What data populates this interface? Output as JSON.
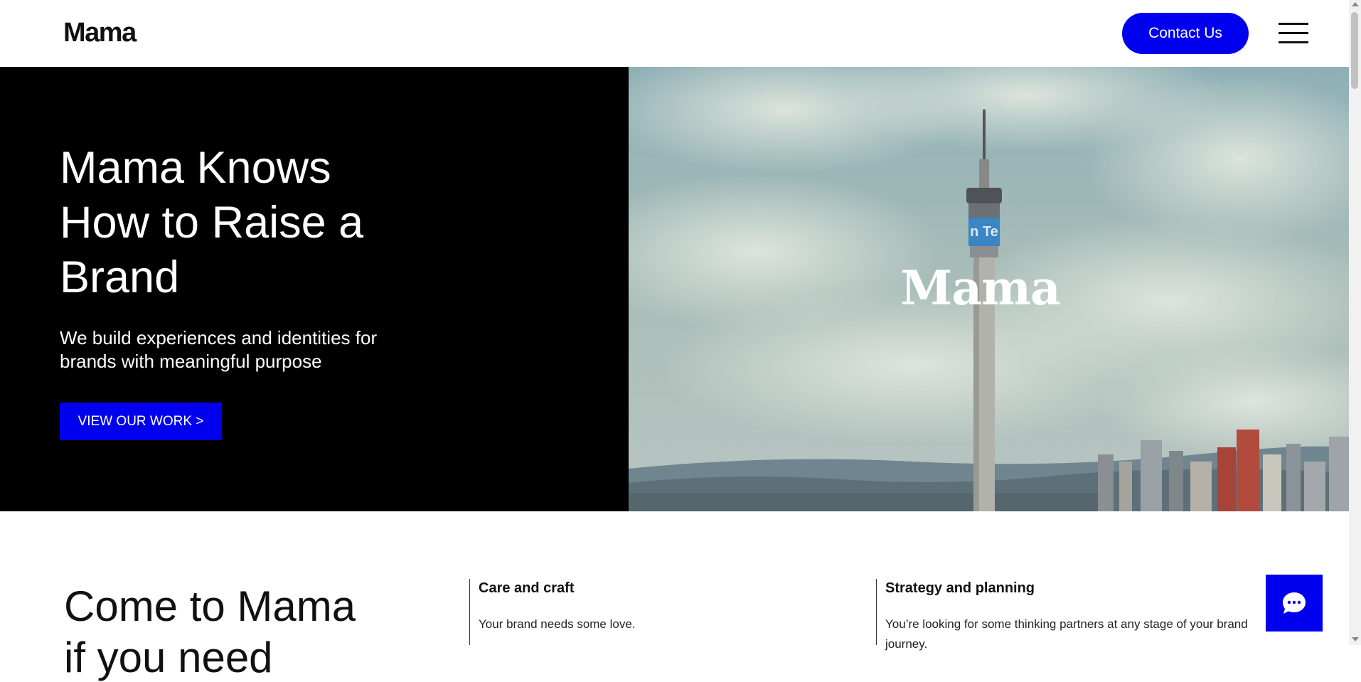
{
  "header": {
    "logo": "Mama",
    "contact_label": "Contact Us",
    "menu_icon": "hamburger-menu-icon"
  },
  "hero": {
    "title": "Mama Knows How to Raise a Brand",
    "subtitle": "We build experiences and identities for brands with meaningful purpose",
    "cta_label": "VIEW OUR WORK >",
    "video_logo": "Mama",
    "tower_sign": "n Te"
  },
  "intro": {
    "title": "Come to Mama",
    "title_line2": "if you need",
    "columns": [
      {
        "heading": "Care and craft",
        "text": "Your brand needs some love."
      },
      {
        "heading": "Strategy and planning",
        "text": "You’re looking for some thinking partners at any stage of your brand journey."
      }
    ]
  },
  "chat": {
    "icon": "chat-bubble-icon"
  },
  "colors": {
    "accent": "#0000ee",
    "hero_bg": "#000000"
  }
}
